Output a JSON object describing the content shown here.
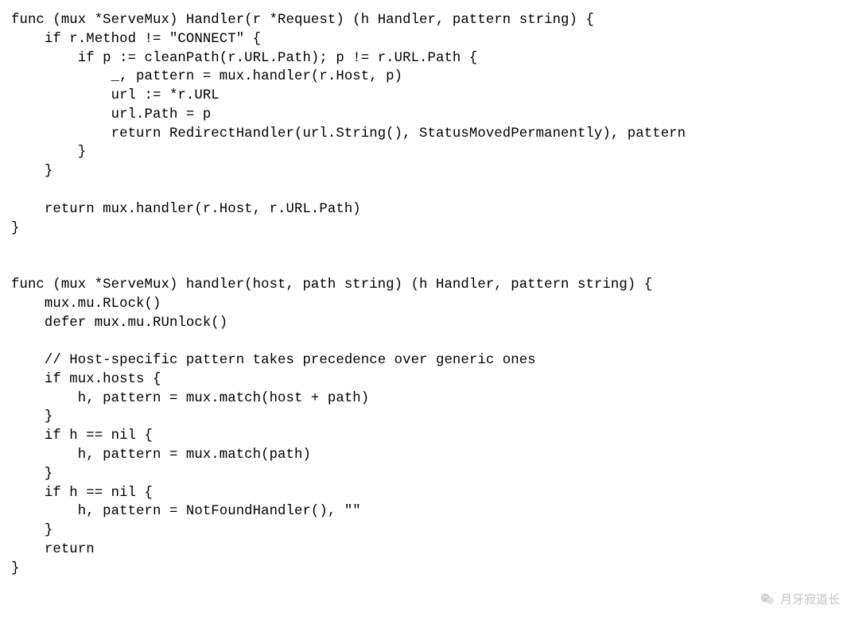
{
  "code_lines": [
    "func (mux *ServeMux) Handler(r *Request) (h Handler, pattern string) {",
    "    if r.Method != \"CONNECT\" {",
    "        if p := cleanPath(r.URL.Path); p != r.URL.Path {",
    "            _, pattern = mux.handler(r.Host, p)",
    "            url := *r.URL",
    "            url.Path = p",
    "            return RedirectHandler(url.String(), StatusMovedPermanently), pattern",
    "        }",
    "    }",
    "",
    "    return mux.handler(r.Host, r.URL.Path)",
    "}",
    "",
    "",
    "func (mux *ServeMux) handler(host, path string) (h Handler, pattern string) {",
    "    mux.mu.RLock()",
    "    defer mux.mu.RUnlock()",
    "",
    "    // Host-specific pattern takes precedence over generic ones",
    "    if mux.hosts {",
    "        h, pattern = mux.match(host + path)",
    "    }",
    "    if h == nil {",
    "        h, pattern = mux.match(path)",
    "    }",
    "    if h == nil {",
    "        h, pattern = NotFoundHandler(), \"\"",
    "    }",
    "    return",
    "}"
  ],
  "code_joined": "",
  "watermark": {
    "icon": "wechat-icon",
    "text": "月牙寂道长"
  }
}
